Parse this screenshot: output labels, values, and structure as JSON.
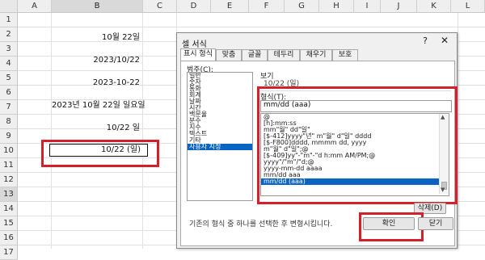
{
  "spreadsheet": {
    "columns": [
      "A",
      "B",
      "C",
      "D",
      "E",
      "F",
      "G",
      "H",
      "I",
      "J",
      "K",
      "L"
    ],
    "rows": [
      "1",
      "2",
      "3",
      "4",
      "5",
      "6",
      "7",
      "8",
      "9",
      "10",
      "11",
      "12",
      "13",
      "14",
      "15",
      "16",
      "17"
    ],
    "cells": {
      "b3": "10월 22일",
      "b5": "2023/10/22",
      "b7": "2023-10-22",
      "b9": "2023년 10월 22일 일요일",
      "b11": "10/22 일",
      "b13": "10/22 (일)"
    }
  },
  "dialog": {
    "title": "셀 서식",
    "help": "?",
    "close": "✕",
    "tabs": [
      "표시 형식",
      "맞춤",
      "글꼴",
      "테두리",
      "채우기",
      "보호"
    ],
    "category_label": "범주(C):",
    "categories": [
      "일반",
      "숫자",
      "통화",
      "회계",
      "날짜",
      "시간",
      "백분율",
      "분수",
      "지수",
      "텍스트",
      "기타",
      "사용자 지정"
    ],
    "preview_label": "보기",
    "preview_value": "10/22 (일)",
    "format_label": "형식(T):",
    "format_value": "mm/dd (aaa)",
    "formats": [
      "@",
      "[h]:mm:ss",
      "mm\"월\" dd\"일\"",
      "[$-412]yyyy\"년\" m\"월\" d\"일\" dddd",
      "[$-F800]dddd, mmmm dd, yyyy",
      "m\"월\" d\"일\";@",
      "[$-409]yy\"-\"m\"-\"d h:mm AM/PM;@",
      "yyyy\"/\"m\"/\"d;@",
      "yyyy-mm-dd aaaa",
      "mm/dd aaa",
      "mm/dd (aaa)"
    ],
    "delete_button": "삭제(D)",
    "description": "기존의 형식 중 하나를 선택한 후 변형시킵니다.",
    "ok_button": "확인",
    "close_button": "닫기"
  },
  "colors": {
    "highlight": "#d2212a",
    "selection": "#0a64c2"
  }
}
